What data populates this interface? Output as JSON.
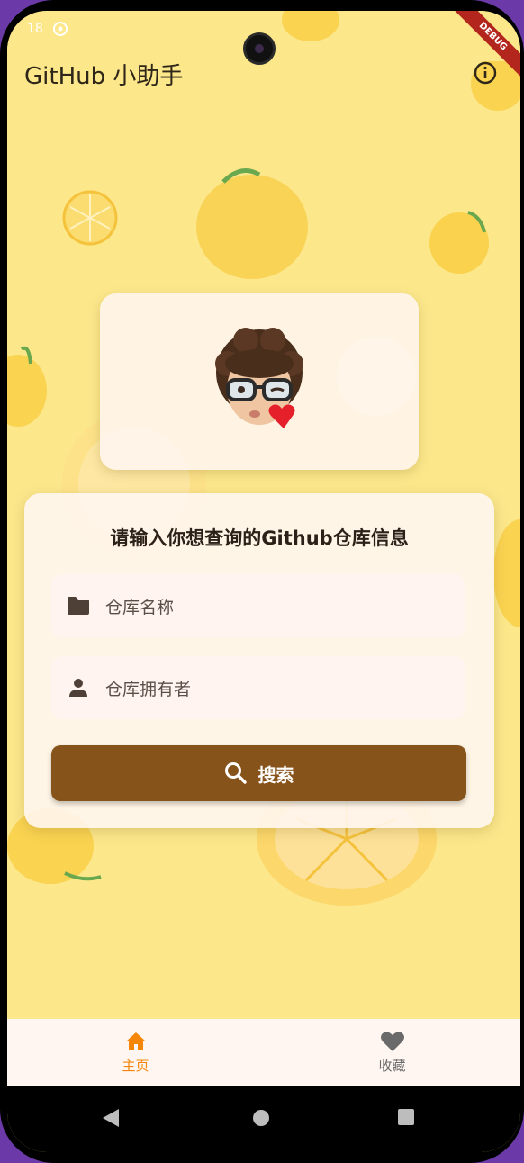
{
  "status_bar": {
    "time": "18"
  },
  "debug_banner": "DEBUG",
  "app_bar": {
    "title": "GitHub 小助手",
    "info_icon": "info-icon"
  },
  "avatar_card": {
    "avatar": "memoji-avatar-with-heart"
  },
  "form": {
    "title": "请输入你想查询的Github仓库信息",
    "repo_name_placeholder": "仓库名称",
    "repo_owner_placeholder": "仓库拥有者",
    "search_label": "搜索"
  },
  "bottom_nav": {
    "items": [
      {
        "label": "主页",
        "icon": "home-icon",
        "active": true
      },
      {
        "label": "收藏",
        "icon": "heart-icon",
        "active": false
      }
    ]
  },
  "colors": {
    "background": "#fce78b",
    "accent": "#86531a",
    "active_tab": "#f5860a",
    "card": "#fff6f0"
  }
}
